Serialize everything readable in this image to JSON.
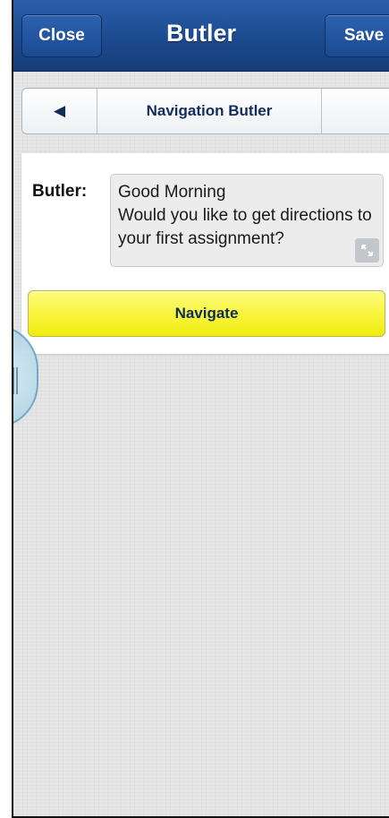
{
  "header": {
    "close_label": "Close",
    "title": "Butler",
    "save_label": "Save"
  },
  "segment": {
    "back_icon": "◀",
    "title": "Navigation Butler"
  },
  "conversation": {
    "speaker": "Butler:",
    "message_line1": "Good Morning",
    "message_line2": "Would you like to get directions to",
    "message_line3": "your first assignment?"
  },
  "actions": {
    "navigate_label": "Navigate"
  },
  "colors": {
    "header": "#1c4a8f",
    "navigate_button": "#f8f43a",
    "background": "#e3e3e3"
  }
}
